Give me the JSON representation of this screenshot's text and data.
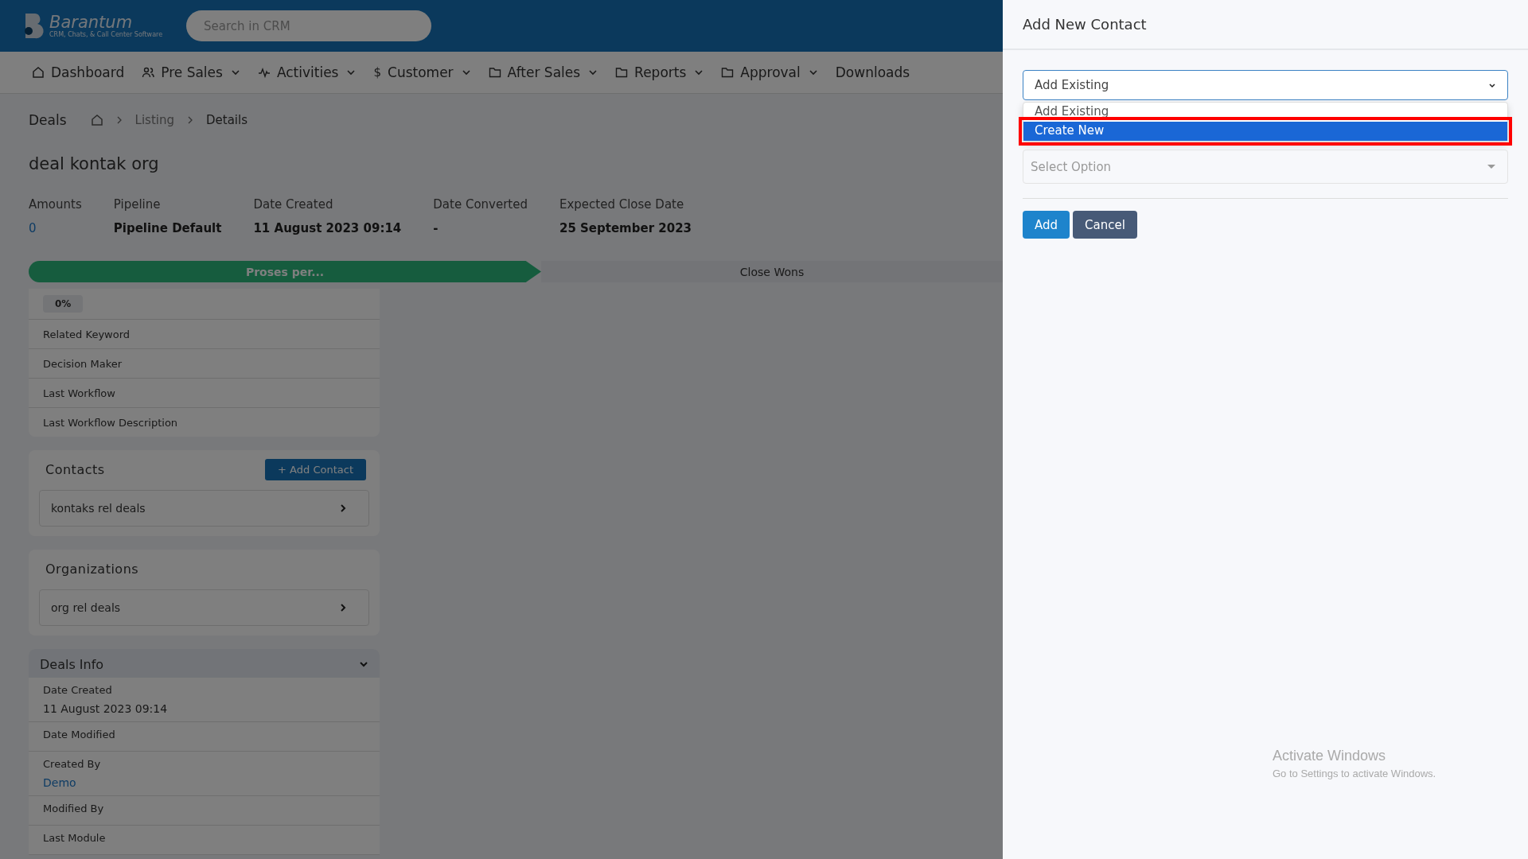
{
  "header": {
    "logo": {
      "name": "Barantum",
      "tagline": "CRM, Chats, & Call Center Software"
    },
    "search": {
      "placeholder": "Search in CRM"
    }
  },
  "nav": [
    {
      "label": "Dashboard",
      "kind": "home",
      "dropdown": false
    },
    {
      "label": "Pre Sales",
      "kind": "people",
      "dropdown": true
    },
    {
      "label": "Activities",
      "kind": "pulse",
      "dropdown": true
    },
    {
      "label": "Customer",
      "kind": "glyph",
      "glyph": "$",
      "dropdown": true
    },
    {
      "label": "After Sales",
      "kind": "folder",
      "dropdown": true
    },
    {
      "label": "Reports",
      "kind": "folder",
      "dropdown": true
    },
    {
      "label": "Approval",
      "kind": "folder",
      "dropdown": true
    },
    {
      "label": "Downloads",
      "kind": "plain",
      "dropdown": false
    }
  ],
  "breadcrumb": {
    "section": "Deals",
    "items": [
      "Listing",
      "Details"
    ]
  },
  "deal": {
    "title": "deal kontak org",
    "fields": [
      {
        "label": "Amounts",
        "value": "0",
        "kind": "link"
      },
      {
        "label": "Pipeline",
        "value": "Pipeline Default",
        "kind": "bold"
      },
      {
        "label": "Date Created",
        "value": "11 August 2023 09:14",
        "kind": "bold"
      },
      {
        "label": "Date Converted",
        "value": "-",
        "kind": "bold"
      },
      {
        "label": "Expected Close Date",
        "value": "25 September 2023",
        "kind": "bold"
      }
    ]
  },
  "stages": [
    {
      "label": "Proses per...",
      "selected": true
    },
    {
      "label": "Close Wons",
      "selected": false
    }
  ],
  "details": {
    "badge": "0%",
    "rows": [
      "Related Keyword",
      "Decision Maker",
      "Last Workflow",
      "Last Workflow Description"
    ]
  },
  "contacts": {
    "title": "Contacts",
    "button": "+ Add Contact",
    "items": [
      "kontaks rel deals"
    ]
  },
  "organizations": {
    "title": "Organizations",
    "items": [
      "org rel deals"
    ]
  },
  "deals_info": {
    "title": "Deals Info",
    "expanded": true,
    "rows": [
      {
        "label": "Date Created",
        "value": "11 August 2023 09:14",
        "kind": "text"
      },
      {
        "label": "Date Modified"
      },
      {
        "label": "Created By",
        "value": "Demo",
        "kind": "link"
      },
      {
        "label": "Modified By"
      },
      {
        "label": "Last Module"
      }
    ]
  },
  "panel": {
    "title": "Add New Contact",
    "select": {
      "value": "Add Existing",
      "options": [
        {
          "label": "Add Existing",
          "highlighted": false
        },
        {
          "label": "Create New",
          "highlighted": true
        }
      ]
    },
    "field": {
      "placeholder": "Select Option"
    },
    "buttons": [
      {
        "label": "Add",
        "kind": "primary"
      },
      {
        "label": "Cancel",
        "kind": "secondary"
      }
    ]
  },
  "os_notice": {
    "title": "Activate Windows",
    "text": "Go to Settings to activate Windows."
  }
}
